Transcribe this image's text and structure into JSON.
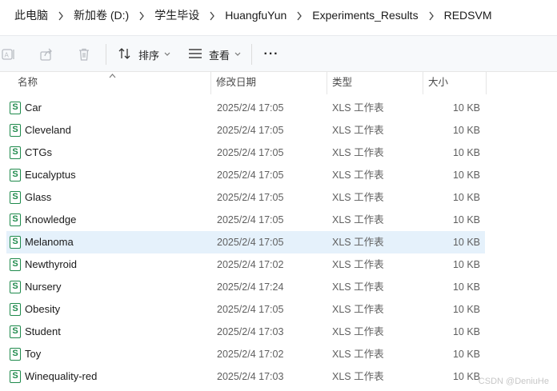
{
  "breadcrumb": [
    "此电脑",
    "新加卷 (D:)",
    "学生毕设",
    "HuangfuYun",
    "Experiments_Results",
    "REDSVM"
  ],
  "toolbar": {
    "sort_label": "排序",
    "view_label": "查看",
    "more_label": "···"
  },
  "columns": {
    "name": "名称",
    "date": "修改日期",
    "type": "类型",
    "size": "大小"
  },
  "files": [
    {
      "name": "Car",
      "date": "2025/2/4 17:05",
      "type": "XLS 工作表",
      "size": "10 KB"
    },
    {
      "name": "Cleveland",
      "date": "2025/2/4 17:05",
      "type": "XLS 工作表",
      "size": "10 KB"
    },
    {
      "name": "CTGs",
      "date": "2025/2/4 17:05",
      "type": "XLS 工作表",
      "size": "10 KB"
    },
    {
      "name": "Eucalyptus",
      "date": "2025/2/4 17:05",
      "type": "XLS 工作表",
      "size": "10 KB"
    },
    {
      "name": "Glass",
      "date": "2025/2/4 17:05",
      "type": "XLS 工作表",
      "size": "10 KB"
    },
    {
      "name": "Knowledge",
      "date": "2025/2/4 17:05",
      "type": "XLS 工作表",
      "size": "10 KB"
    },
    {
      "name": "Melanoma",
      "date": "2025/2/4 17:05",
      "type": "XLS 工作表",
      "size": "10 KB",
      "selected": true
    },
    {
      "name": "Newthyroid",
      "date": "2025/2/4 17:02",
      "type": "XLS 工作表",
      "size": "10 KB"
    },
    {
      "name": "Nursery",
      "date": "2025/2/4 17:24",
      "type": "XLS 工作表",
      "size": "10 KB"
    },
    {
      "name": "Obesity",
      "date": "2025/2/4 17:05",
      "type": "XLS 工作表",
      "size": "10 KB"
    },
    {
      "name": "Student",
      "date": "2025/2/4 17:03",
      "type": "XLS 工作表",
      "size": "10 KB"
    },
    {
      "name": "Toy",
      "date": "2025/2/4 17:02",
      "type": "XLS 工作表",
      "size": "10 KB"
    },
    {
      "name": "Winequality-red",
      "date": "2025/2/4 17:03",
      "type": "XLS 工作表",
      "size": "10 KB"
    }
  ],
  "file_icon_letter": "S",
  "watermark": "CSDN @DeniuHe",
  "colors": {
    "selected_row": "#e5f1fb",
    "xls_icon": "#1f8a4c",
    "toolbar_bg": "#f7f9fb"
  }
}
